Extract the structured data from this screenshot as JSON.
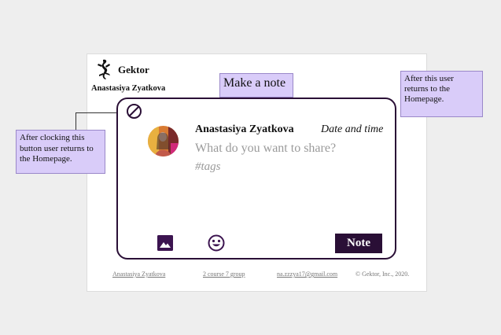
{
  "header": {
    "brand": "Gektor",
    "username": "Anastasiya Zyatkova",
    "logo_icon": "lizard-logo-icon"
  },
  "callouts": {
    "title": "Make a note",
    "right": "After this user returns to the Homepage.",
    "left": "After clocking this button user returns to the Homepage."
  },
  "note_card": {
    "author": "Anastasiya Zyatkova",
    "date": "Date and time",
    "placeholder": "What do you want to share?",
    "tags_placeholder": "#tags",
    "submit_label": "Note",
    "close_icon": "cancel-icon",
    "image_icon": "image-icon",
    "emoji_icon": "smile-icon"
  },
  "footer": {
    "author_link": "Anastasiya Zyatkova",
    "group_link": "2 course 7 group",
    "email_link": "na.zzzya17@gmail.com",
    "copyright": "© Gektor, Inc., 2020."
  },
  "colors": {
    "accent": "#2a0f36",
    "callout_bg": "#d9ccf9",
    "page_bg": "#eeeeee"
  }
}
